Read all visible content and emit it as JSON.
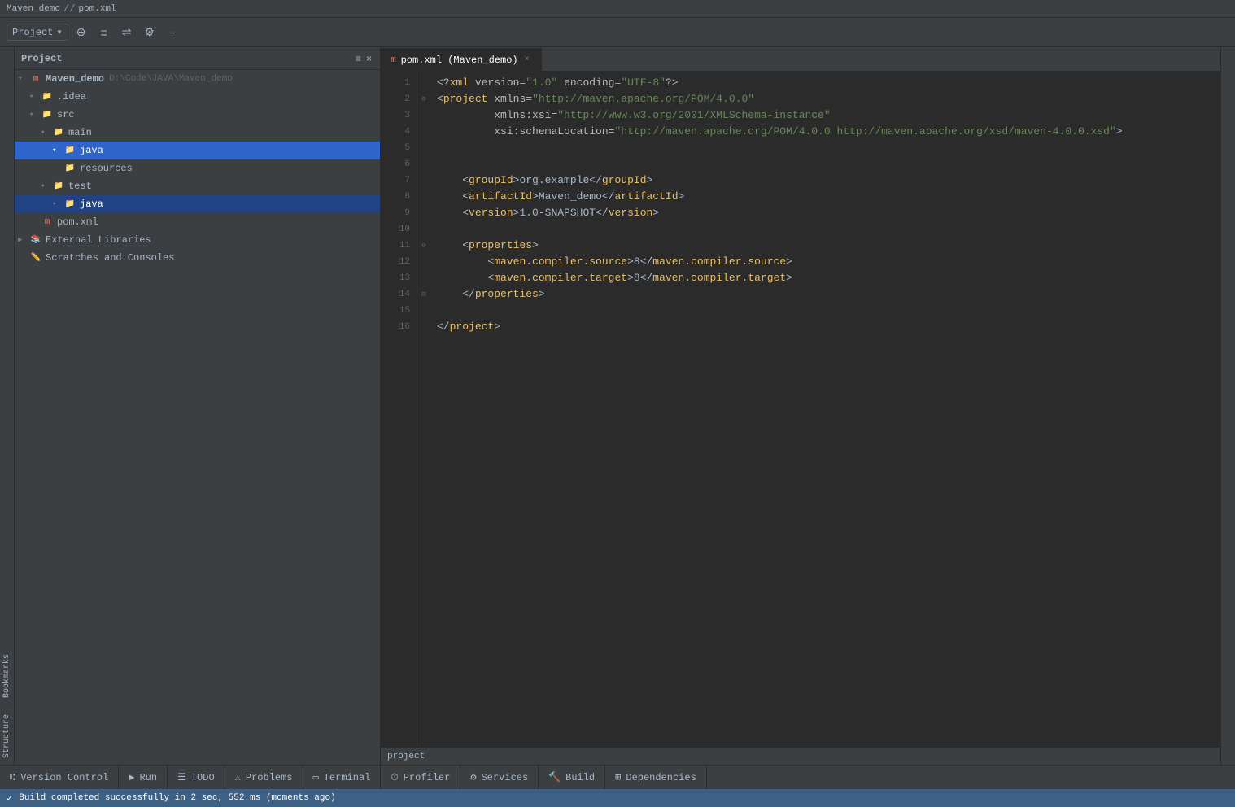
{
  "titleBar": {
    "project": "Maven_demo",
    "separator": "//",
    "file": "pom.xml"
  },
  "toolbar": {
    "projectLabel": "Project",
    "dropdownArrow": "▾",
    "buttons": [
      "⊕",
      "≡",
      "⇌",
      "⚙",
      "−"
    ]
  },
  "projectPanel": {
    "title": "Project",
    "items": [
      {
        "indent": 0,
        "arrow": "▾",
        "icon": "maven",
        "label": "Maven_demo",
        "path": "D:\\Code\\JAVA\\Maven_demo",
        "type": "maven-root"
      },
      {
        "indent": 1,
        "arrow": "▾",
        "icon": "folder-gray",
        "label": ".idea",
        "type": "folder"
      },
      {
        "indent": 1,
        "arrow": "▾",
        "icon": "folder-gray",
        "label": "src",
        "type": "folder"
      },
      {
        "indent": 2,
        "arrow": "▾",
        "icon": "folder-yellow",
        "label": "main",
        "type": "folder"
      },
      {
        "indent": 3,
        "arrow": "▾",
        "icon": "folder-blue",
        "label": "java",
        "type": "java-folder",
        "selected": true
      },
      {
        "indent": 3,
        "arrow": "",
        "icon": "folder-yellow",
        "label": "resources",
        "type": "folder"
      },
      {
        "indent": 2,
        "arrow": "▾",
        "icon": "folder-yellow",
        "label": "test",
        "type": "folder"
      },
      {
        "indent": 3,
        "arrow": "▾",
        "icon": "folder-blue",
        "label": "java",
        "type": "java-folder",
        "selected2": true
      },
      {
        "indent": 1,
        "arrow": "",
        "icon": "maven-xml",
        "label": "pom.xml",
        "type": "pom"
      },
      {
        "indent": 0,
        "arrow": "▶",
        "icon": "lib",
        "label": "External Libraries",
        "type": "library"
      },
      {
        "indent": 0,
        "arrow": "",
        "icon": "scratches",
        "label": "Scratches and Consoles",
        "type": "scratches"
      }
    ]
  },
  "editor": {
    "tab": {
      "icon": "maven",
      "label": "pom.xml (Maven_demo)",
      "closeable": true
    },
    "statusBar": {
      "text": "project"
    },
    "lines": [
      {
        "num": 1,
        "fold": false,
        "content": "<?xml version=\"1.0\" encoding=\"UTF-8\"?>"
      },
      {
        "num": 2,
        "fold": false,
        "content": "<project xmlns=\"http://maven.apache.org/POM/4.0.0\""
      },
      {
        "num": 3,
        "fold": false,
        "content": "         xmlns:xsi=\"http://www.w3.org/2001/XMLSchema-instance\""
      },
      {
        "num": 4,
        "fold": false,
        "content": "         xsi:schemaLocation=\"http://maven.apache.org/POM/4.0.0 http://maven.apache.org/xsd/maven-4.0.0.xsd\">"
      },
      {
        "num": 5,
        "fold": false,
        "content": ""
      },
      {
        "num": 6,
        "fold": false,
        "content": ""
      },
      {
        "num": 7,
        "fold": false,
        "content": "    <groupId>org.example</groupId>"
      },
      {
        "num": 8,
        "fold": false,
        "content": "    <artifactId>Maven_demo</artifactId>"
      },
      {
        "num": 9,
        "fold": false,
        "content": "    <version>1.0-SNAPSHOT</version>"
      },
      {
        "num": 10,
        "fold": false,
        "content": ""
      },
      {
        "num": 11,
        "fold": true,
        "content": "    <properties>"
      },
      {
        "num": 12,
        "fold": false,
        "content": "        <maven.compiler.source>8</maven.compiler.source>"
      },
      {
        "num": 13,
        "fold": false,
        "content": "        <maven.compiler.target>8</maven.compiler.target>"
      },
      {
        "num": 14,
        "fold": true,
        "content": "    </properties>"
      },
      {
        "num": 15,
        "fold": false,
        "content": ""
      },
      {
        "num": 16,
        "fold": false,
        "content": "</project>"
      }
    ]
  },
  "bottomTabs": [
    {
      "icon": "▶",
      "label": "Version Control"
    },
    {
      "icon": "▶",
      "label": "Run"
    },
    {
      "icon": "☰",
      "label": "TODO"
    },
    {
      "icon": "⚠",
      "label": "Problems"
    },
    {
      "icon": "▭",
      "label": "Terminal"
    },
    {
      "icon": "⏱",
      "label": "Profiler"
    },
    {
      "icon": "⚙",
      "label": "Services"
    },
    {
      "icon": "🔨",
      "label": "Build"
    },
    {
      "icon": "⊞",
      "label": "Dependencies"
    }
  ],
  "statusBar": {
    "buildMessage": "Build completed successfully in 2 sec, 552 ms (moments ago)"
  },
  "sideLabels": {
    "structure": "Structure",
    "bookmarks": "Bookmarks"
  }
}
